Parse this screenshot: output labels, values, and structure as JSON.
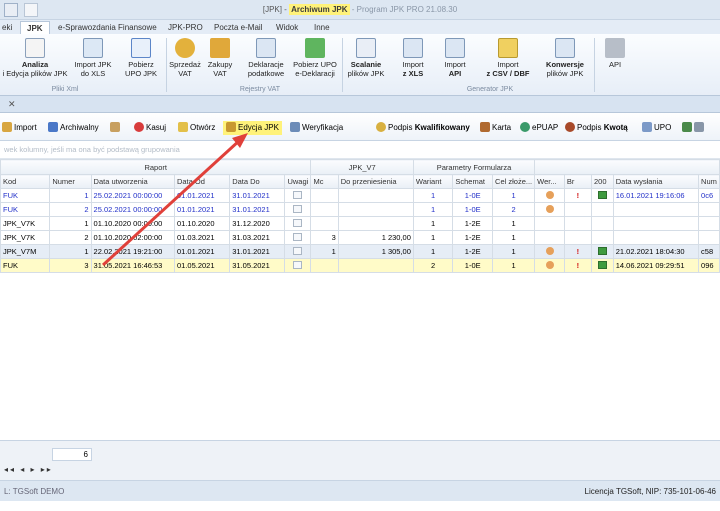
{
  "window": {
    "title_prefix": "[JPK] - ",
    "title_highlight": "Archiwum JPK",
    "title_suffix": " - Program  JPK PRO  21.08.30"
  },
  "tabs": [
    "eki",
    "JPK",
    "e-Sprawozdania Finansowe",
    "JPK-PRO",
    "Poczta e-Mail",
    "Widok",
    "Inne"
  ],
  "ribbon": {
    "buttons": [
      {
        "l1": "Analiza",
        "l2": "i Edycja plików JPK",
        "bold": true
      },
      {
        "l1": "Import JPK",
        "l2": "do XLS"
      },
      {
        "l1": "Pobierz",
        "l2": "UPO JPK"
      },
      {
        "l1": "Sprzedaż",
        "l2": "VAT"
      },
      {
        "l1": "Zakupy",
        "l2": "VAT"
      },
      {
        "l1": "Deklaracje",
        "l2": "podatkowe"
      },
      {
        "l1": "Pobierz UPO",
        "l2": "e-Deklaracji"
      },
      {
        "l1": "Scalanie",
        "l2": "plików JPK",
        "bold": true
      },
      {
        "l1": "Import",
        "l2": "z XLS",
        "bold2": true
      },
      {
        "l1": "Import",
        "l2": "API",
        "bold2": true
      },
      {
        "l1": "Import",
        "l2": "z CSV / DBF",
        "bold2": true
      },
      {
        "l1": "Konwersje",
        "l2": "plików JPK",
        "bold": true
      },
      {
        "l1": "API",
        "l2": ""
      }
    ],
    "groups": [
      "Pliki Xml",
      "Rejestry VAT",
      "Generator JPK"
    ]
  },
  "toolbar": [
    {
      "label": "Import"
    },
    {
      "label": "Archiwalny"
    },
    {
      "label": ""
    },
    {
      "label": "Kasuj"
    },
    {
      "label": "Otwórz"
    },
    {
      "label": "Edycja JPK",
      "highlight": true
    },
    {
      "label": "Weryfikacja"
    },
    {
      "label": "Podpis ",
      "bold": "Kwalifikowany"
    },
    {
      "label": "Karta"
    },
    {
      "label": "ePUAP"
    },
    {
      "label": "Podpis ",
      "bold": "Kwotą"
    },
    {
      "label": "UPO"
    }
  ],
  "groupbar_hint": "wek kolumny, jeśli ma ona być podstawą grupowania",
  "grid": {
    "groups": [
      "Raport",
      "JPK_V7",
      "Parametry Formularza"
    ],
    "headers": [
      "Kod",
      "Numer",
      "Data utworzenia",
      "Data Od",
      "Data Do",
      "Uwagi",
      "Mc",
      "Do przeniesienia",
      "Wariant",
      "Schemat",
      "Cel złoże...",
      "Wer...",
      "Br",
      "200",
      "Data wysłania",
      "Num"
    ],
    "rows": [
      {
        "kod": "FUK",
        "numer": "1",
        "utw": "25.02.2021 00:00:00",
        "od": "01.01.2021",
        "do": "31.01.2021",
        "mc": "",
        "przen": "",
        "wariant": "1",
        "schemat": "1-0E",
        "cel": "1",
        "wer": true,
        "br": true,
        "s200": true,
        "wys": "16.01.2021 19:16:06",
        "num": "0c6",
        "style": "blue"
      },
      {
        "kod": "FUK",
        "numer": "2",
        "utw": "25.02.2021 00:00:00",
        "od": "01.01.2021",
        "do": "31.01.2021",
        "mc": "",
        "przen": "",
        "wariant": "1",
        "schemat": "1-0E",
        "cel": "2",
        "wer": true,
        "br": false,
        "s200": false,
        "wys": "",
        "num": "",
        "style": "blue"
      },
      {
        "kod": "JPK_V7K",
        "numer": "1",
        "utw": "01.10.2020 00:00:00",
        "od": "01.10.2020",
        "do": "31.12.2020",
        "mc": "",
        "przen": "",
        "wariant": "1",
        "schemat": "1-2E",
        "cel": "1",
        "wer": false,
        "br": false,
        "s200": false,
        "wys": "",
        "num": "",
        "style": ""
      },
      {
        "kod": "JPK_V7K",
        "numer": "2",
        "utw": "01.10.2020 02:00:00",
        "od": "01.03.2021",
        "do": "31.03.2021",
        "mc": "3",
        "przen": "1 230,00",
        "wariant": "1",
        "schemat": "1-2E",
        "cel": "1",
        "wer": false,
        "br": false,
        "s200": false,
        "wys": "",
        "num": "",
        "style": ""
      },
      {
        "kod": "JPK_V7M",
        "numer": "1",
        "utw": "22.02.2021 19:21:00",
        "od": "01.01.2021",
        "do": "31.01.2021",
        "mc": "1",
        "przen": "1 305,00",
        "wariant": "1",
        "schemat": "1-2E",
        "cel": "1",
        "wer": true,
        "br": true,
        "s200": true,
        "wys": "21.02.2021 18:04:30",
        "num": "c58",
        "style": "sel"
      },
      {
        "kod": "FUK",
        "numer": "3",
        "utw": "31.05.2021 16:46:53",
        "od": "01.05.2021",
        "do": "31.05.2021",
        "mc": "",
        "przen": "",
        "wariant": "2",
        "schemat": "1-0E",
        "cel": "1",
        "wer": true,
        "br": true,
        "s200": true,
        "wys": "14.06.2021 09:29:51",
        "num": "096",
        "style": "yel"
      }
    ]
  },
  "footer": {
    "count": "6",
    "pager": "◂◂ ◂ ▸ ▸▸",
    "status_left": "L: TGSoft DEMO",
    "status_right": "Licencja TGSoft,  NIP: 735-101-06-46"
  },
  "colors": {
    "highlight": "#fff27a",
    "arrow": "#e0403a"
  }
}
